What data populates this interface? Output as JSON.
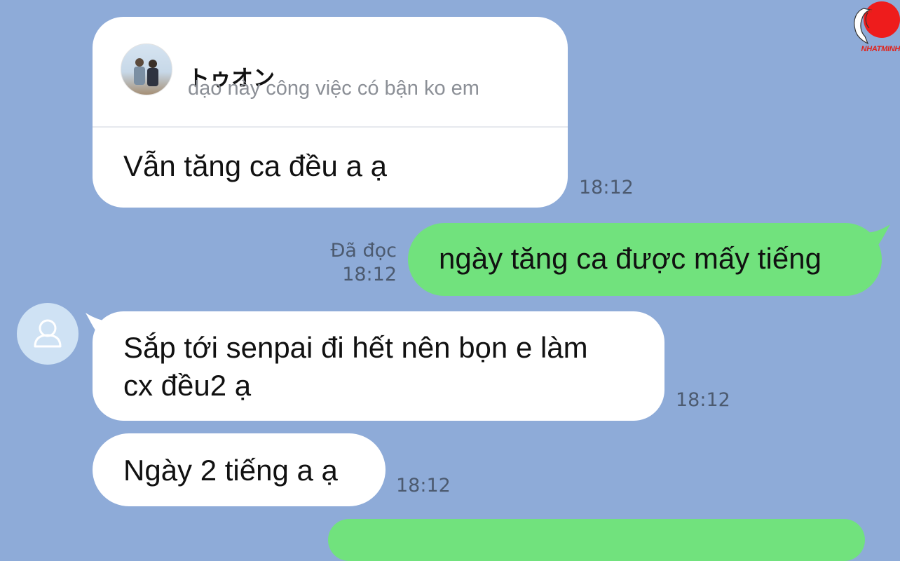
{
  "reply": {
    "quoted_name": "トゥオン",
    "quoted_message": "dạo này công việc có bận ko em",
    "text": "Vẫn tăng ca đều a ạ",
    "time": "18:12"
  },
  "sent": [
    {
      "status": "Đã đọc",
      "time": "18:12",
      "text": "ngày tăng ca được mấy tiếng"
    }
  ],
  "received": [
    {
      "text_line1": "Sắp tới senpai đi hết nên bọn e làm",
      "text_line2": "cx đều2 ạ",
      "time": "18:12"
    },
    {
      "text": "Ngày 2 tiếng a ạ",
      "time": "18:12"
    }
  ],
  "watermark": {
    "text": "NHATMINH"
  },
  "colors": {
    "background": "#8eabd8",
    "sent_bubble": "#71e27d",
    "received_bubble": "#ffffff"
  },
  "icons": {
    "sender_avatar": "user-icon",
    "logo": "crane-sun-logo"
  }
}
